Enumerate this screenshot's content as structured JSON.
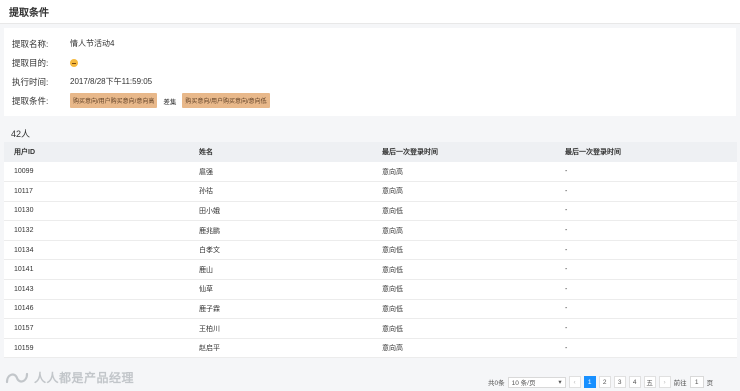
{
  "header": {
    "title": "提取条件"
  },
  "conditions": {
    "name_label": "提取名称:",
    "name_value": "情人节活动4",
    "purpose_label": "提取目的:",
    "time_label": "执行时间:",
    "time_value": "2017/8/28下午11:59:05",
    "cond_label": "提取条件:",
    "tag1": "购买意向/用户购买意向/意向高",
    "operator": "差集",
    "tag2": "购买意向/用户购买意向/意向低"
  },
  "result": {
    "count": "42人"
  },
  "table": {
    "headers": [
      "用户ID",
      "姓名",
      "最后一次登录时间",
      "最后一次登录时间"
    ],
    "rows": [
      [
        "10099",
        "扈强",
        "意向高",
        "-"
      ],
      [
        "10117",
        "孙祜",
        "意向高",
        "-"
      ],
      [
        "10130",
        "田小娥",
        "意向低",
        "-"
      ],
      [
        "10132",
        "鹿兆鹏",
        "意向高",
        "-"
      ],
      [
        "10134",
        "白孝文",
        "意向低",
        "-"
      ],
      [
        "10141",
        "鹿山",
        "意向低",
        "-"
      ],
      [
        "10143",
        "仙草",
        "意向低",
        "-"
      ],
      [
        "10146",
        "鹿子霖",
        "意向低",
        "-"
      ],
      [
        "10157",
        "王柏川",
        "意向低",
        "-"
      ],
      [
        "10159",
        "赵启平",
        "意向高",
        "-"
      ]
    ]
  },
  "pager": {
    "total": "共0条",
    "page_size": "10 条/页",
    "prev": "‹",
    "pages": [
      "1",
      "2",
      "3",
      "4",
      "五"
    ],
    "next": "›",
    "goto_label": "前往",
    "goto_value": "1",
    "page_suffix": "页"
  },
  "watermark": {
    "text": "人人都是产品经理"
  }
}
